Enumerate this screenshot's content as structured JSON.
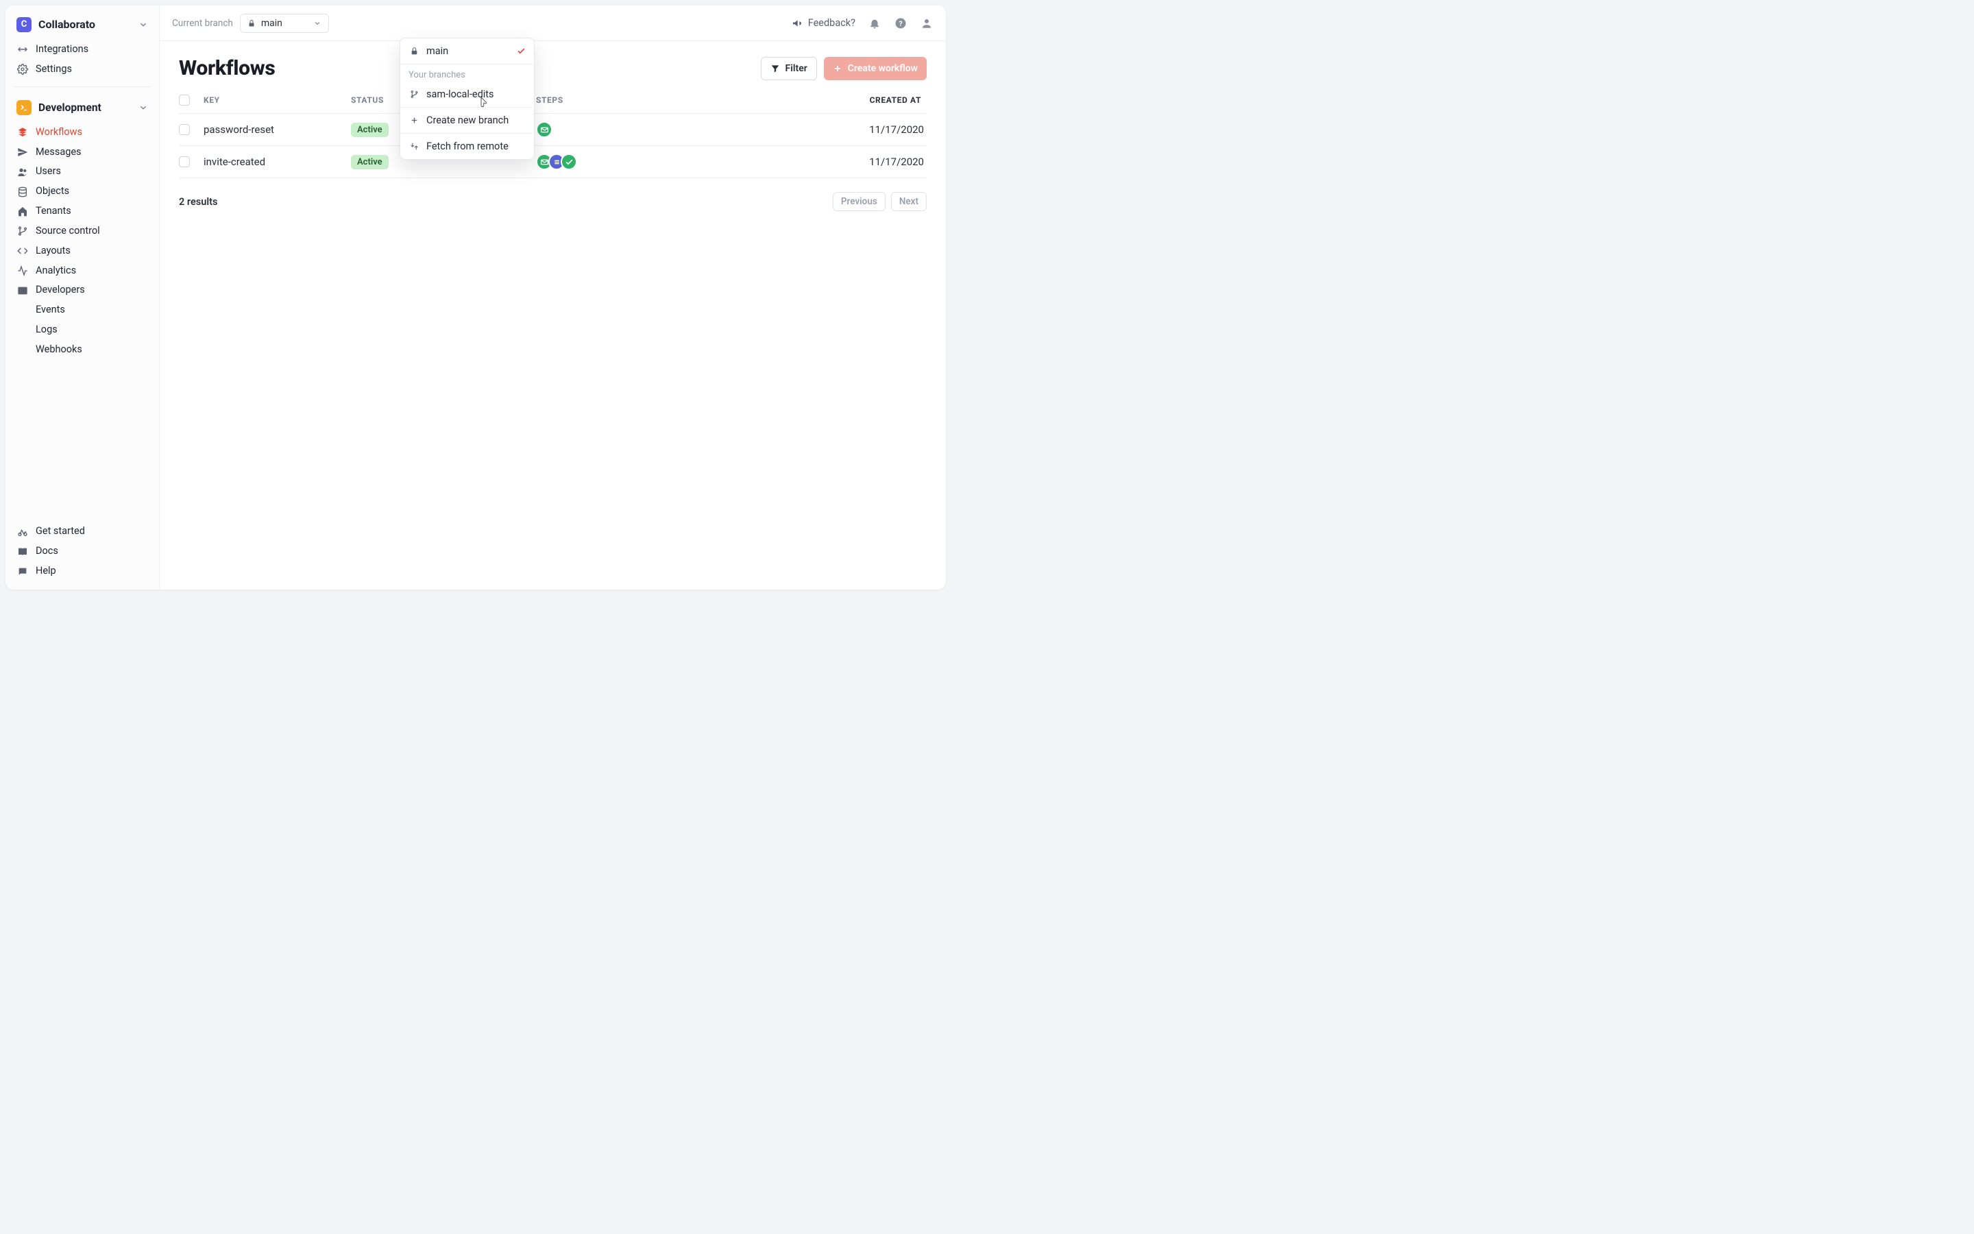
{
  "brand": {
    "name": "Collaborato",
    "initial": "C"
  },
  "sidebar": {
    "integrations": "Integrations",
    "settings": "Settings",
    "section": "Development",
    "items": [
      {
        "label": "Workflows"
      },
      {
        "label": "Messages"
      },
      {
        "label": "Users"
      },
      {
        "label": "Objects"
      },
      {
        "label": "Tenants"
      },
      {
        "label": "Source control"
      },
      {
        "label": "Layouts"
      },
      {
        "label": "Analytics"
      },
      {
        "label": "Developers"
      }
    ],
    "dev_children": [
      {
        "label": "Events"
      },
      {
        "label": "Logs"
      },
      {
        "label": "Webhooks"
      }
    ],
    "footer": [
      {
        "label": "Get started"
      },
      {
        "label": "Docs"
      },
      {
        "label": "Help"
      }
    ]
  },
  "topbar": {
    "current_branch_label": "Current branch",
    "current_branch": "main",
    "feedback": "Feedback?"
  },
  "branch_dropdown": {
    "main": "main",
    "your_branches_label": "Your branches",
    "branches": [
      "sam-local-edits"
    ],
    "create_new": "Create new branch",
    "fetch": "Fetch from remote"
  },
  "page": {
    "title": "Workflows",
    "filter": "Filter",
    "create": "Create workflow"
  },
  "table": {
    "headers": {
      "key": "KEY",
      "status": "STATUS",
      "steps": "STEPS",
      "created": "CREATED AT"
    },
    "rows": [
      {
        "key": "password-reset",
        "status": "Active",
        "steps": [
          "green"
        ],
        "created": "11/17/2020"
      },
      {
        "key": "invite-created",
        "status": "Active",
        "steps": [
          "green",
          "blue",
          "green"
        ],
        "created": "11/17/2020"
      }
    ],
    "results": "2 results",
    "prev": "Previous",
    "next": "Next"
  }
}
